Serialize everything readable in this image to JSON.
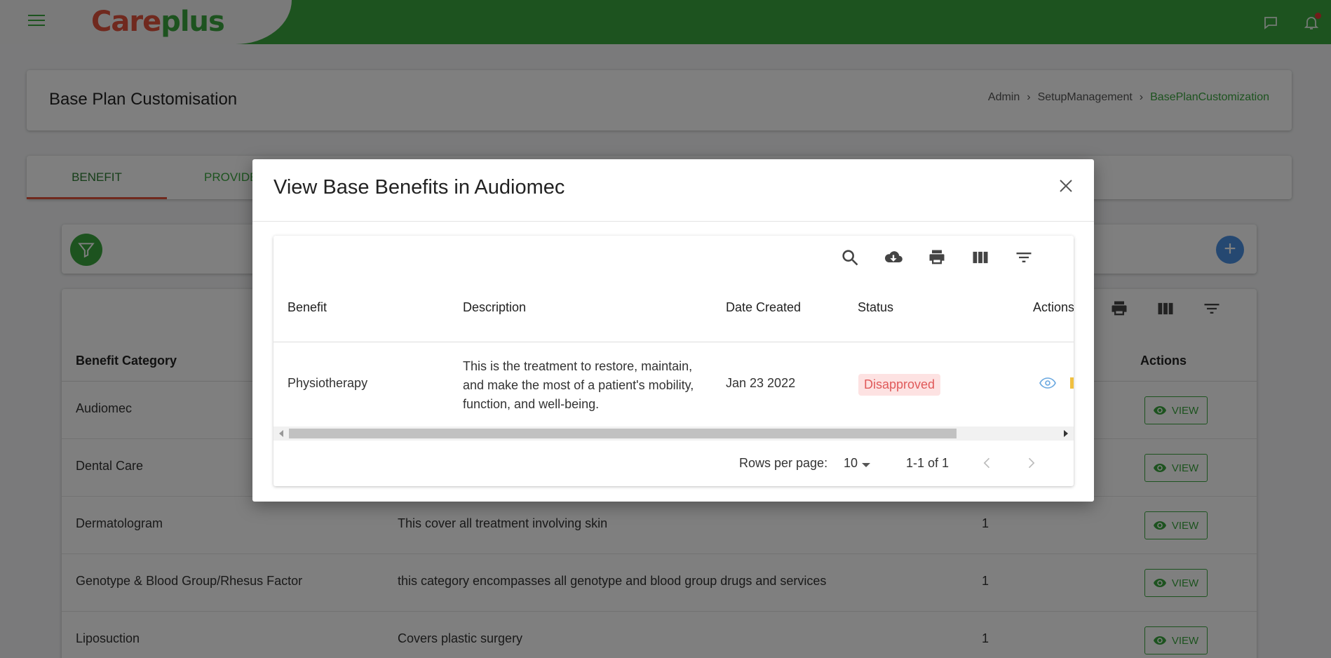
{
  "app": {
    "logo_part1": "Care",
    "logo_part2": "plus",
    "brand_color": "#3aa63f"
  },
  "page": {
    "title": "Base Plan Customisation",
    "breadcrumb": [
      "Admin",
      "SetupManagement",
      "BasePlanCustomization"
    ]
  },
  "tabs": [
    {
      "label": "BENEFIT",
      "active": true
    },
    {
      "label": "PROVIDE",
      "active": false
    }
  ],
  "main_table": {
    "headers": {
      "category": "Benefit Category",
      "actions": "Actions"
    },
    "view_label": "VIEW",
    "rows": [
      {
        "category": "Audiomec",
        "description": "",
        "count": ""
      },
      {
        "category": "Dental Care",
        "description": "",
        "count": ""
      },
      {
        "category": "Dermatologram",
        "description": "This cover all treatment involving skin",
        "count": "1"
      },
      {
        "category": "Genotype & Blood Group/Rhesus Factor",
        "description": "this category encompasses all genotype and blood group drugs and services",
        "count": "1"
      },
      {
        "category": "Liposuction",
        "description": "Covers plastic surgery",
        "count": "1"
      }
    ]
  },
  "modal": {
    "title": "View Base Benefits in Audiomec",
    "toolbar_icons": [
      "search-icon",
      "download-icon",
      "print-icon",
      "columns-icon",
      "filter-icon"
    ],
    "headers": {
      "benefit": "Benefit",
      "description": "Description",
      "date_created": "Date Created",
      "status": "Status",
      "actions": "Actions"
    },
    "row": {
      "benefit": "Physiotherapy",
      "description_line1": "This is the treatment to restore, maintain,",
      "description_line2": "and make the most of a patient's mobility,",
      "description_line3": "function, and well-being.",
      "date_created": "Jan 23 2022",
      "status": "Disapproved"
    },
    "pagination": {
      "rows_per_page_label": "Rows per page:",
      "rows_per_page": "10",
      "range": "1-1 of 1"
    }
  }
}
